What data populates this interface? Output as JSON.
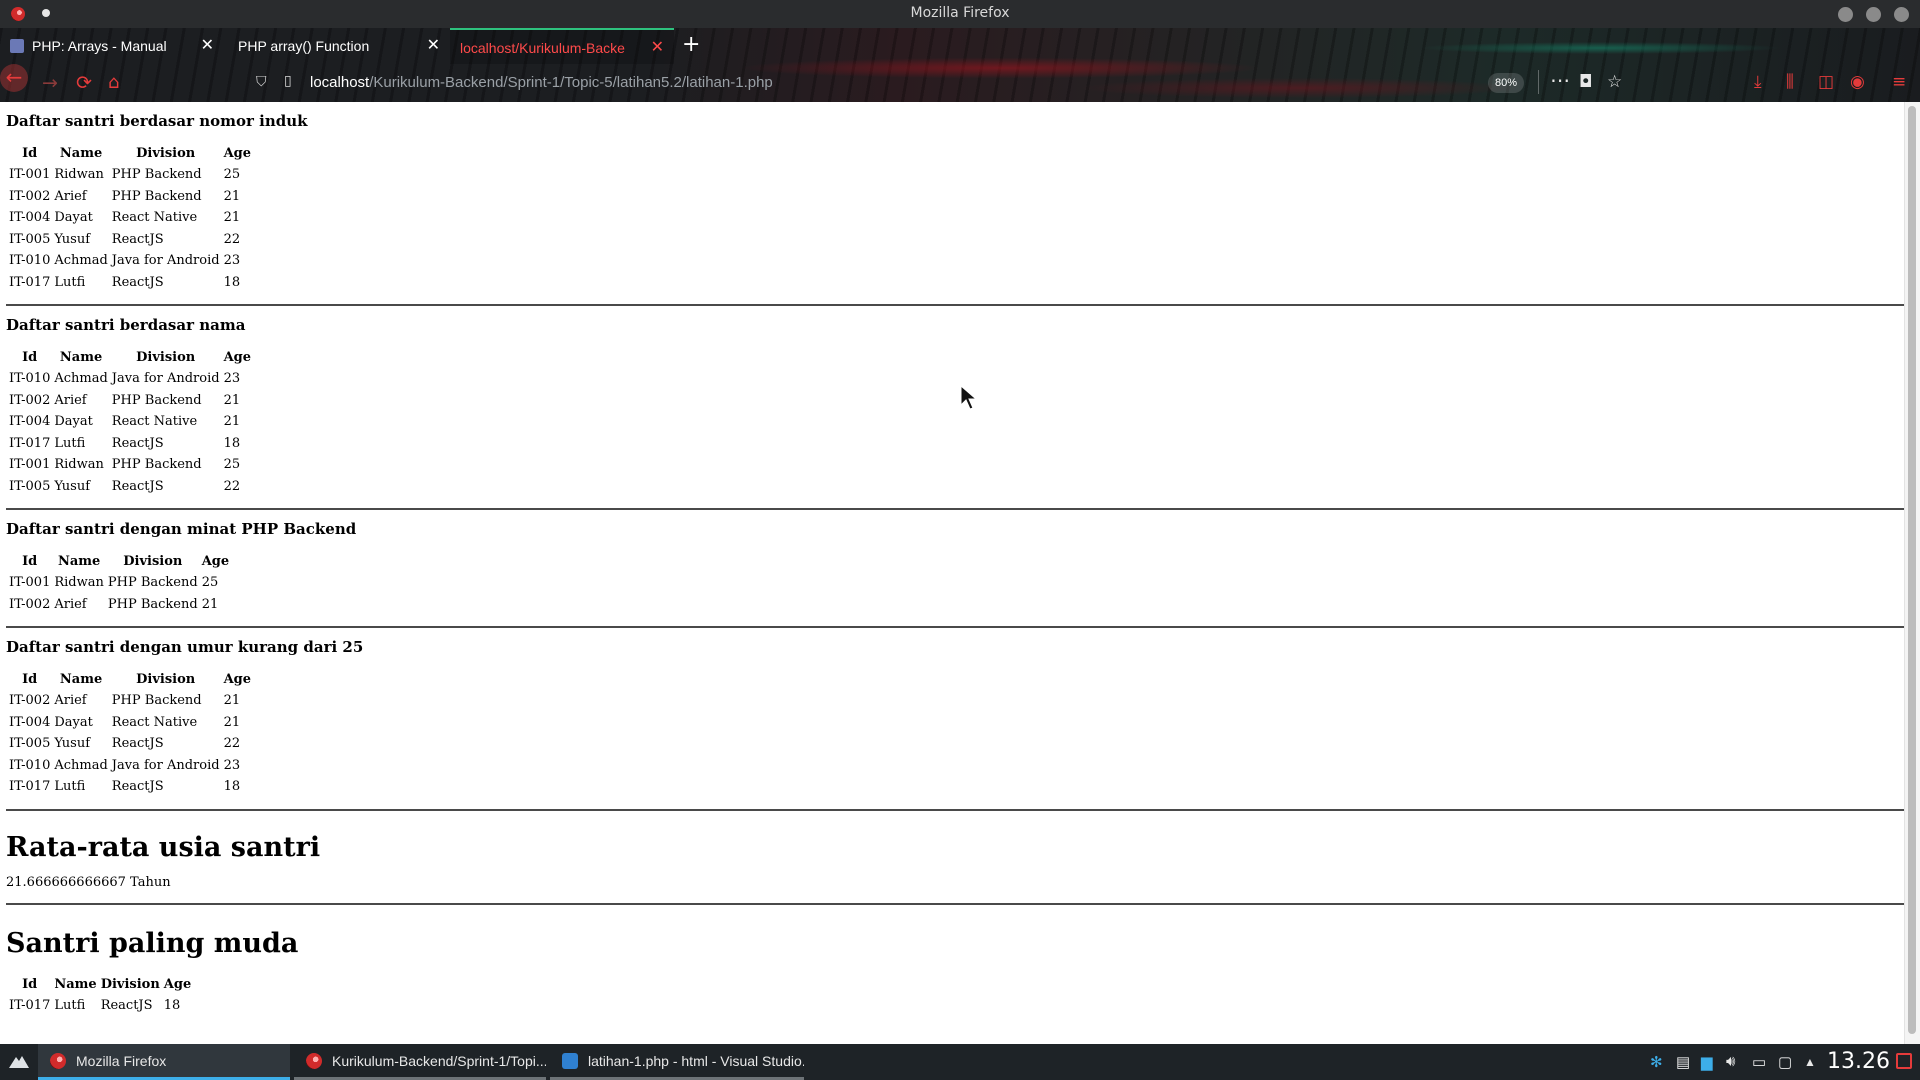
{
  "window": {
    "title": "Mozilla Firefox"
  },
  "tabs": [
    {
      "label": "PHP: Arrays - Manual",
      "icon": "php-favicon",
      "active": false
    },
    {
      "label": "PHP array() Function",
      "icon": "none",
      "active": false
    },
    {
      "label": "localhost/Kurikulum-Backe",
      "icon": "none",
      "active": true
    }
  ],
  "navbar": {
    "url_host": "localhost",
    "url_path": "/Kurikulum-Backend/Sprint-1/Topic-5/latihan5.2/latihan-1.php",
    "zoom": "80%"
  },
  "page": {
    "sections": [
      {
        "title": "Daftar santri berdasar nomor induk",
        "headers": [
          "Id",
          "Name",
          "Division",
          "Age"
        ],
        "rows": [
          [
            "IT-001",
            "Ridwan",
            "PHP Backend",
            "25"
          ],
          [
            "IT-002",
            "Arief",
            "PHP Backend",
            "21"
          ],
          [
            "IT-004",
            "Dayat",
            "React Native",
            "21"
          ],
          [
            "IT-005",
            "Yusuf",
            "ReactJS",
            "22"
          ],
          [
            "IT-010",
            "Achmad",
            "Java for Android",
            "23"
          ],
          [
            "IT-017",
            "Lutfi",
            "ReactJS",
            "18"
          ]
        ]
      },
      {
        "title": "Daftar santri berdasar nama",
        "headers": [
          "Id",
          "Name",
          "Division",
          "Age"
        ],
        "rows": [
          [
            "IT-010",
            "Achmad",
            "Java for Android",
            "23"
          ],
          [
            "IT-002",
            "Arief",
            "PHP Backend",
            "21"
          ],
          [
            "IT-004",
            "Dayat",
            "React Native",
            "21"
          ],
          [
            "IT-017",
            "Lutfi",
            "ReactJS",
            "18"
          ],
          [
            "IT-001",
            "Ridwan",
            "PHP Backend",
            "25"
          ],
          [
            "IT-005",
            "Yusuf",
            "ReactJS",
            "22"
          ]
        ]
      },
      {
        "title": "Daftar santri dengan minat PHP Backend",
        "headers": [
          "Id",
          "Name",
          "Division",
          "Age"
        ],
        "rows": [
          [
            "IT-001",
            "Ridwan",
            "PHP Backend",
            "25"
          ],
          [
            "IT-002",
            "Arief",
            "PHP Backend",
            "21"
          ]
        ]
      },
      {
        "title": "Daftar santri dengan umur kurang dari 25",
        "headers": [
          "Id",
          "Name",
          "Division",
          "Age"
        ],
        "rows": [
          [
            "IT-002",
            "Arief",
            "PHP Backend",
            "21"
          ],
          [
            "IT-004",
            "Dayat",
            "React Native",
            "21"
          ],
          [
            "IT-005",
            "Yusuf",
            "ReactJS",
            "22"
          ],
          [
            "IT-010",
            "Achmad",
            "Java for Android",
            "23"
          ],
          [
            "IT-017",
            "Lutfi",
            "ReactJS",
            "18"
          ]
        ]
      }
    ],
    "average": {
      "title": "Rata-rata usia santri",
      "value": "21.666666666667 Tahun"
    },
    "youngest": {
      "title": "Santri paling muda",
      "headers": [
        "Id",
        "Name",
        "Division",
        "Age"
      ],
      "rows": [
        [
          "IT-017",
          "Lutfi",
          "ReactJS",
          "18"
        ]
      ]
    }
  },
  "taskbar": {
    "tasks": [
      {
        "label": "Mozilla Firefox",
        "icon": "firefox-icon",
        "active": true
      },
      {
        "label": "Kurikulum-Backend/Sprint-1/Topi...",
        "icon": "firefox-icon",
        "active": false
      },
      {
        "label": "latihan-1.php - html - Visual Studio...",
        "icon": "vscode-icon",
        "active": false
      }
    ],
    "clock": "13.26"
  },
  "colors": {
    "accent_red": "#e53b3b",
    "active_tab_border": "#2ec27e",
    "taskbar_bg": "#1e2327",
    "task_active_underline": "#3daee9"
  }
}
